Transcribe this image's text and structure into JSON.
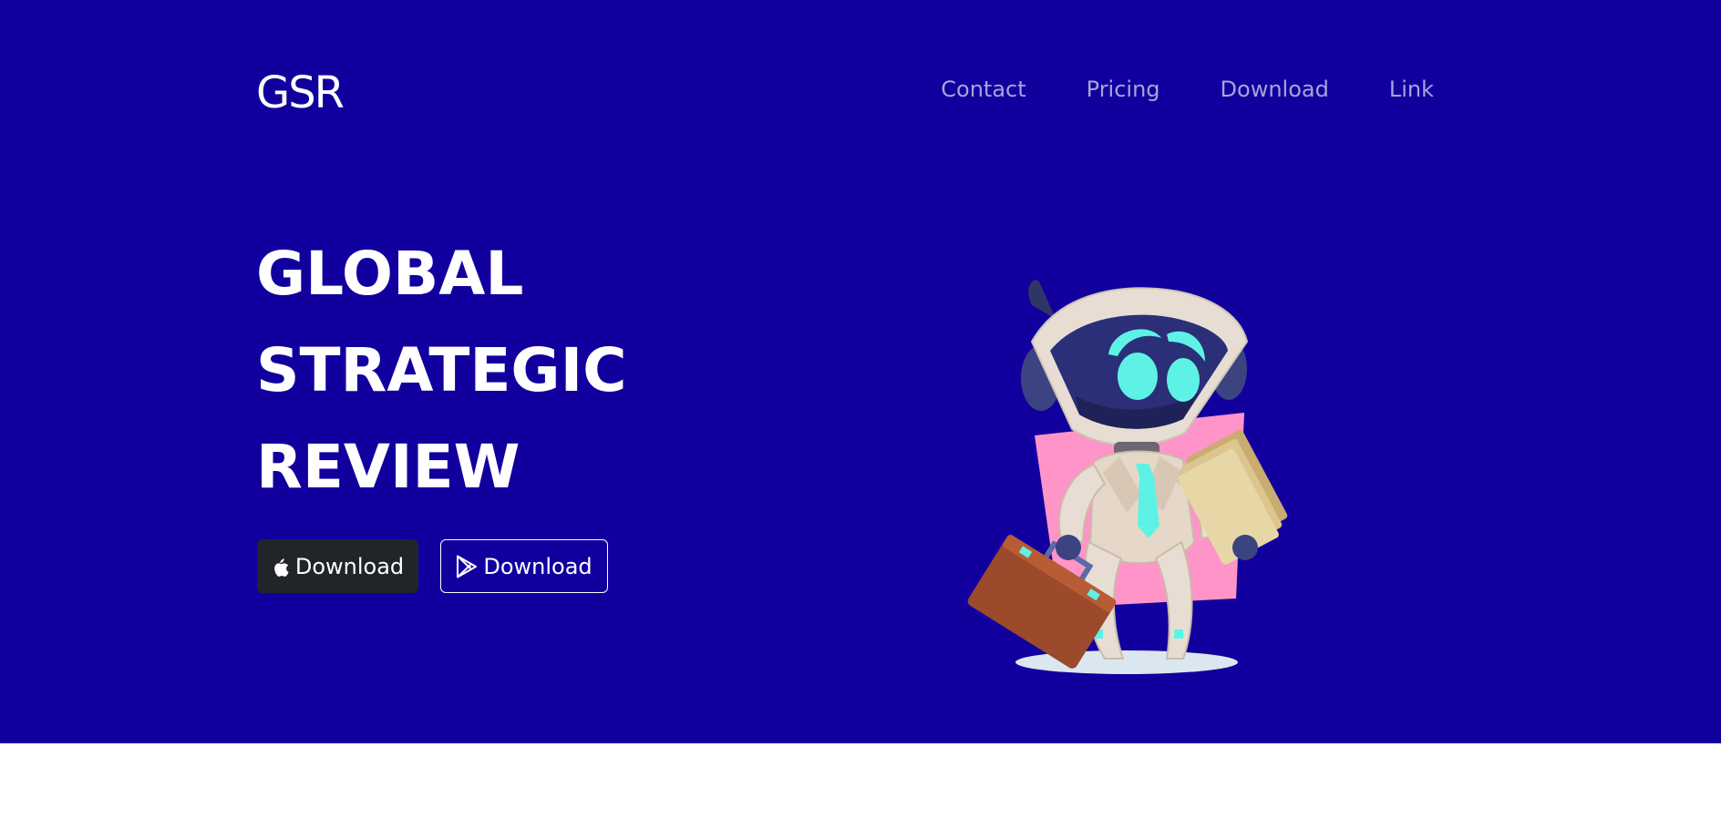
{
  "brand": {
    "name": "GSR"
  },
  "nav": {
    "items": [
      {
        "label": "Contact"
      },
      {
        "label": "Pricing"
      },
      {
        "label": "Download"
      },
      {
        "label": "Link"
      }
    ]
  },
  "hero": {
    "headline_lines": [
      "GLOBAL",
      "STRATEGIC",
      "REVIEW"
    ],
    "buttons": {
      "apple_label": "Download",
      "apple_icon": "apple-icon",
      "play_label": "Download",
      "play_icon": "google-play-icon"
    },
    "illustration": "robot-businessman-illustration"
  },
  "colors": {
    "hero_background": "#12009e",
    "nav_link": "#a7a4d9",
    "dark_button": "#212529",
    "accent_pink": "#ff94c8",
    "accent_cyan": "#5ef2e6"
  }
}
